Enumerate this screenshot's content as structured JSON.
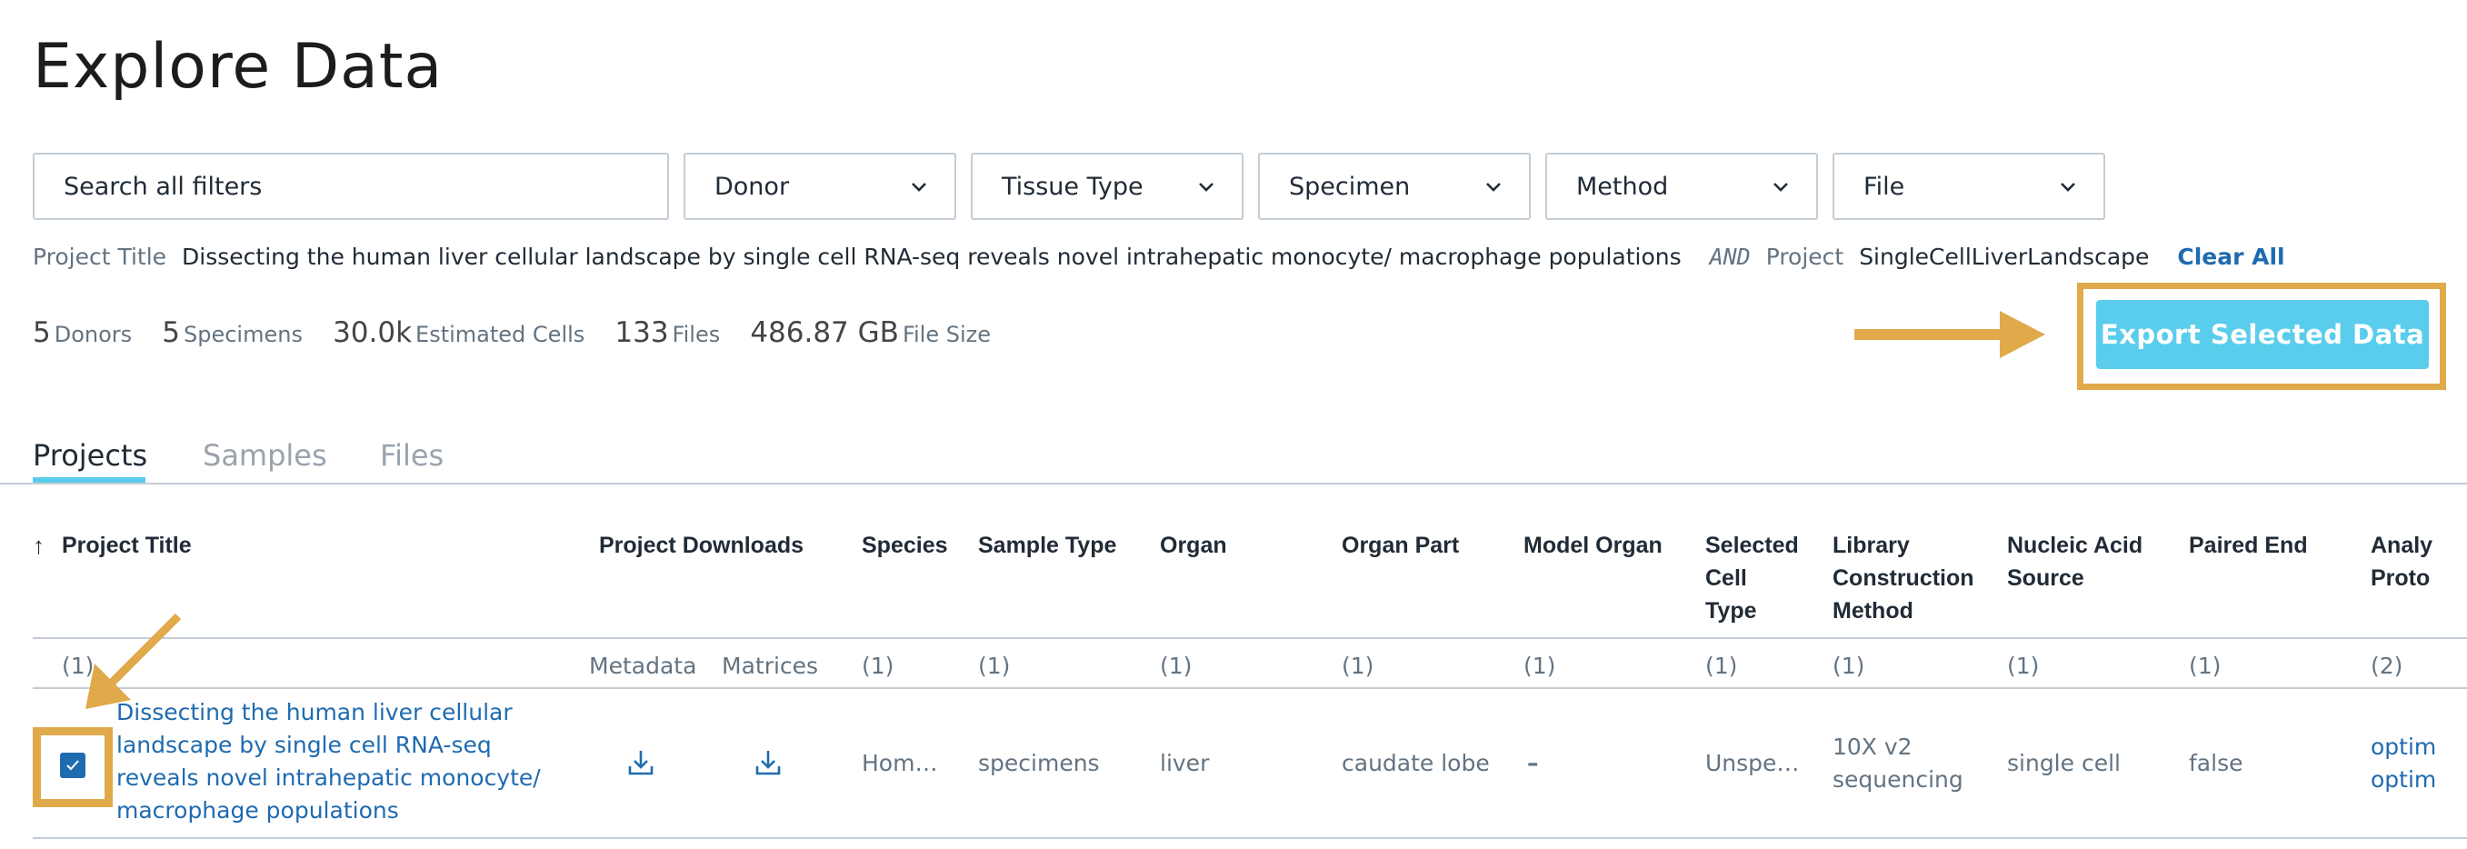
{
  "page": {
    "title": "Explore Data"
  },
  "search": {
    "placeholder": "Search all filters"
  },
  "filters": [
    "Donor",
    "Tissue Type",
    "Specimen",
    "Method",
    "File"
  ],
  "breadcrumb": {
    "project_title_key": "Project Title",
    "project_title_value": "Dissecting the human liver cellular landscape by single cell RNA-seq reveals novel intrahepatic monocyte/ macrophage populations",
    "and": "AND",
    "project_key": "Project",
    "project_value": "SingleCellLiverLandscape",
    "clear_all": "Clear All"
  },
  "stats": [
    {
      "num": "5",
      "label": "Donors"
    },
    {
      "num": "5",
      "label": "Specimens"
    },
    {
      "num": "30.0k",
      "label": "Estimated Cells"
    },
    {
      "num": "133",
      "label": "Files"
    },
    {
      "num": "486.87 GB",
      "label": "File Size"
    }
  ],
  "export_button": "Export Selected Data",
  "tabs": [
    "Projects",
    "Samples",
    "Files"
  ],
  "table": {
    "sort_icon": "↑",
    "headers": {
      "project_title": "Project Title",
      "project_downloads": "Project Downloads",
      "species": "Species",
      "sample_type": "Sample Type",
      "organ": "Organ",
      "organ_part": "Organ Part",
      "model_organ": "Model Organ",
      "selected_cell_type": [
        "Selected",
        "Cell",
        "Type"
      ],
      "library_construction": [
        "Library",
        "Construction",
        "Method"
      ],
      "nucleic_acid": [
        "Nucleic Acid",
        "Source"
      ],
      "paired_end": "Paired End",
      "analysis_protocol": [
        "Analy",
        "Proto"
      ]
    },
    "subheaders": {
      "project_title": "(1)",
      "metadata": "Metadata",
      "matrices": "Matrices",
      "species": "(1)",
      "sample_type": "(1)",
      "organ": "(1)",
      "organ_part": "(1)",
      "model_organ": "(1)",
      "selected_cell_type": "(1)",
      "library_construction": "(1)",
      "nucleic_acid": "(1)",
      "paired_end": "(1)",
      "analysis_protocol": "(2)"
    },
    "row": {
      "project_title_lines": [
        "Dissecting the human liver cellular",
        "landscape by single cell RNA-seq",
        "reveals novel intrahepatic monocyte/",
        "macrophage populations"
      ],
      "species": "Hom…",
      "sample_type": "specimens",
      "organ": "liver",
      "organ_part": "caudate lobe",
      "model_organ": "–",
      "selected_cell_type": "Unspe…",
      "library_construction": [
        "10X v2",
        "sequencing"
      ],
      "nucleic_acid": "single cell",
      "paired_end": "false",
      "analysis_protocol": [
        "optim",
        "optim"
      ]
    }
  },
  "colors": {
    "accent": "#5bcdec",
    "annotation": "#e0a94a",
    "link": "#1f6bb0"
  }
}
